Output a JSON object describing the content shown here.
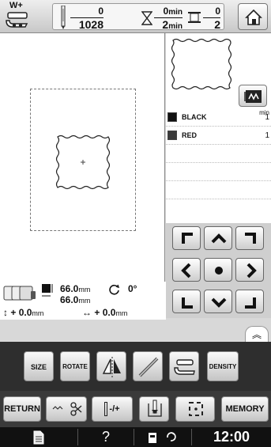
{
  "top_bar": {
    "foot_pressure_label": "W+",
    "stitch_count": {
      "current": "0",
      "total": "1028"
    },
    "time": {
      "current": "0",
      "total": "2",
      "unit": "min"
    },
    "color_change": {
      "current": "0",
      "total": "2"
    },
    "home_icon": "home-icon"
  },
  "colors": {
    "list": [
      {
        "name": "BLACK",
        "minutes": "1",
        "swatch": "#111111"
      },
      {
        "name": "RED",
        "minutes": "1",
        "swatch": "#3a3a3a"
      }
    ],
    "min_header": "min"
  },
  "info": {
    "width": "66.0",
    "height": "66.0",
    "unit": "mm",
    "rotation": "0°",
    "offset_y": "0.0",
    "offset_x": "0.0",
    "plus_sign": "+"
  },
  "edit_buttons": {
    "size": "SIZE",
    "rotate": "ROTATE",
    "density": "DENSITY"
  },
  "sew_buttons": {
    "return": "RETURN",
    "needle_toggle": "-/+",
    "memory": "MEMORY"
  },
  "status": {
    "help": "?",
    "clock": "12:00"
  }
}
